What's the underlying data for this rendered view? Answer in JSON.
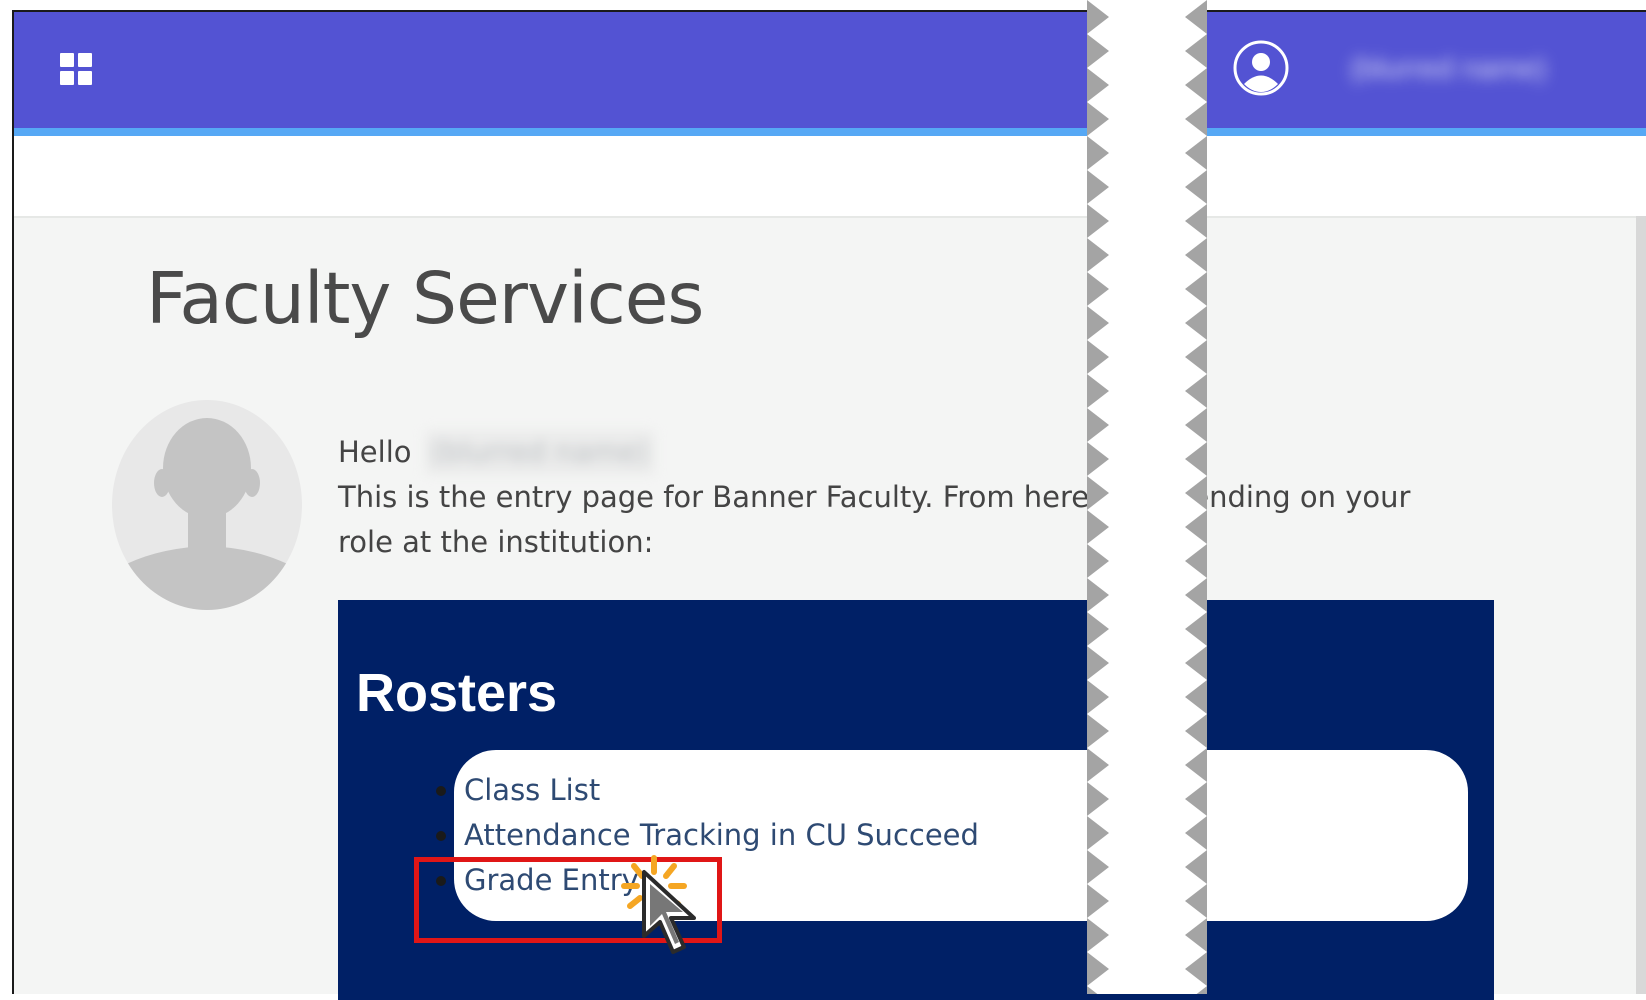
{
  "header": {
    "app_menu_icon": "grid-icon",
    "user_icon": "user-circle-icon",
    "user_name": "(blurred name)"
  },
  "page": {
    "title": "Faculty Services",
    "avatar_icon": "person-silhouette-icon",
    "greeting": "Hello",
    "greeting_name": "(blurred name)",
    "intro": "This is the entry page for Banner Faculty. From here … depending on your role at the institution:"
  },
  "rosters": {
    "title": "Rosters",
    "links": [
      {
        "label": "Class List"
      },
      {
        "label": "Attendance Tracking in CU Succeed"
      },
      {
        "label": "Grade Entry"
      }
    ]
  },
  "annotation": {
    "highlight_color": "#e01616",
    "burst_color": "#f5a623",
    "cursor_icon": "pointer-arrow-icon"
  },
  "colors": {
    "topbar": "#5353d3",
    "accent": "#56a8f5",
    "rosters_panel": "#002066",
    "link": "#2e4a73"
  }
}
